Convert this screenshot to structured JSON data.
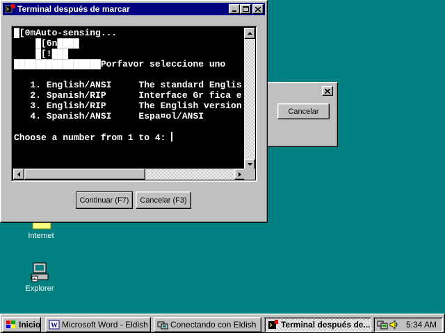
{
  "desktop": {
    "icons": [
      {
        "label": "Internet",
        "icon": "internet-icon"
      },
      {
        "label": "Explorer",
        "icon": "explorer-icon"
      }
    ]
  },
  "background_dialog": {
    "cancel_label": "Cancelar"
  },
  "window": {
    "title": "Terminal después de marcar",
    "terminal_lines": [
      "█[0mAuto-sensing...",
      "    █[6n████",
      "    █[!███",
      "████████████████Porfavor seleccione uno",
      "",
      "   1. English/ANSI     The standard Englis",
      "   2. Spanish/RIP      Interface Gr fica e",
      "   3. English/RIP      The English version",
      "   4. Spanish/ANSI     Espa¤ol/ANSI",
      "",
      "Choose a number from 1 to 4: "
    ],
    "continue_label": "Continuar (F7)",
    "cancel_label": "Cancelar (F3)"
  },
  "taskbar": {
    "start_label": "Inicio",
    "tasks": [
      {
        "label": "Microsoft Word - Eldish",
        "active": false
      },
      {
        "label": "Conectando con Eldish",
        "active": false
      },
      {
        "label": "Terminal después de...",
        "active": true
      }
    ],
    "clock": "5:34 AM"
  },
  "colors": {
    "desktop": "#008080",
    "title_active": "#000080",
    "face": "#c0c0c0"
  }
}
